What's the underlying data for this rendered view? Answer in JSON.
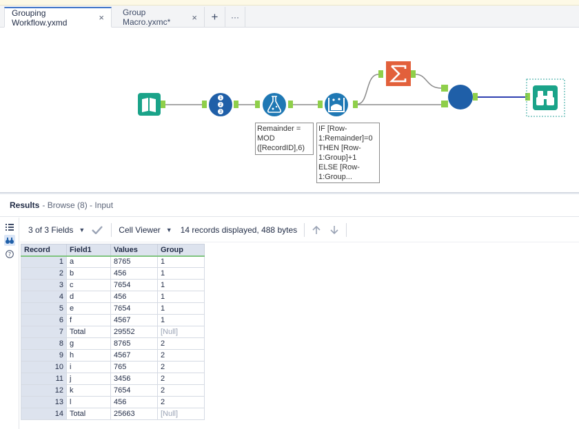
{
  "tabs": [
    {
      "label": "Grouping Workflow.yxmd",
      "close": "×",
      "active": true
    },
    {
      "label": "Group Macro.yxmc*",
      "close": "×",
      "active": false
    }
  ],
  "tab_tools": {
    "add": "+",
    "more": "···"
  },
  "canvas": {
    "tools": [
      {
        "name": "input-data-tool",
        "icon": "book-icon",
        "color": "#1aa389"
      },
      {
        "name": "record-id-tool",
        "icon": "numbered-list-icon",
        "color": "#1f5fa8"
      },
      {
        "name": "formula-tool",
        "icon": "flask-icon",
        "color": "#1f78b4"
      },
      {
        "name": "multi-row-formula-tool",
        "icon": "multi-row-icon",
        "color": "#1f78b4"
      },
      {
        "name": "summarize-tool",
        "icon": "sigma-icon",
        "color": "#e2603b"
      },
      {
        "name": "union-tool",
        "icon": "circle-icon",
        "color": "#1f5fa8"
      },
      {
        "name": "browse-tool",
        "icon": "binoculars-icon",
        "color": "#1aa389"
      }
    ],
    "connector_color": "#8fcf4a",
    "annotations": {
      "formula": "Remainder =\nMOD\n([RecordID],6)",
      "multi_row": "IF [Row-\n1:Remainder]=0\nTHEN [Row-\n1:Group]+1\nELSE [Row-\n1:Group..."
    }
  },
  "results": {
    "title": "Results",
    "subtitle": "- Browse (8) - Input"
  },
  "toolbar": {
    "fields": "3 of 3 Fields",
    "viewer": "Cell Viewer",
    "status": "14 records displayed, 488 bytes"
  },
  "grid": {
    "columns": [
      "Record",
      "Field1",
      "Values",
      "Group"
    ],
    "rows": [
      [
        "1",
        "a",
        "8765",
        "1"
      ],
      [
        "2",
        "b",
        "456",
        "1"
      ],
      [
        "3",
        "c",
        "7654",
        "1"
      ],
      [
        "4",
        "d",
        "456",
        "1"
      ],
      [
        "5",
        "e",
        "7654",
        "1"
      ],
      [
        "6",
        "f",
        "4567",
        "1"
      ],
      [
        "7",
        "Total",
        "29552",
        "[Null]"
      ],
      [
        "8",
        "g",
        "8765",
        "2"
      ],
      [
        "9",
        "h",
        "4567",
        "2"
      ],
      [
        "10",
        "i",
        "765",
        "2"
      ],
      [
        "11",
        "j",
        "3456",
        "2"
      ],
      [
        "12",
        "k",
        "7654",
        "2"
      ],
      [
        "13",
        "l",
        "456",
        "2"
      ],
      [
        "14",
        "Total",
        "25663",
        "[Null]"
      ]
    ]
  }
}
